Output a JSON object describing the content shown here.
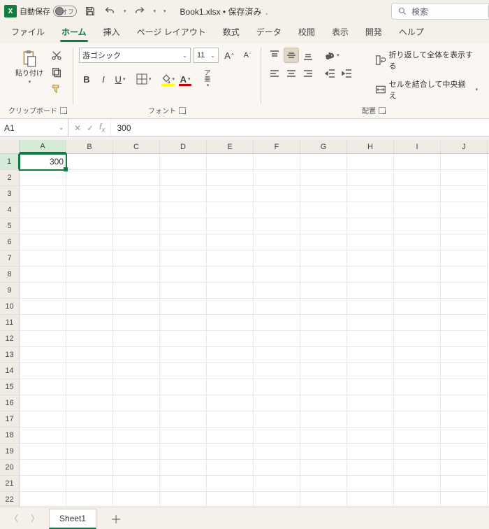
{
  "title": {
    "autosave_label": "自動保存",
    "autosave_state": "オフ",
    "filename": "Book1.xlsx",
    "saved_state": "保存済み"
  },
  "search": {
    "placeholder": "検索"
  },
  "tabs": {
    "file": "ファイル",
    "home": "ホーム",
    "insert": "挿入",
    "layout": "ページ レイアウト",
    "formulas": "数式",
    "data": "データ",
    "review": "校閲",
    "view": "表示",
    "developer": "開発",
    "help": "ヘルプ"
  },
  "ribbon": {
    "clipboard": {
      "paste": "貼り付け",
      "label": "クリップボード"
    },
    "font": {
      "name": "游ゴシック",
      "size": "11",
      "label": "フォント",
      "ruby": "ア\n亜"
    },
    "alignment": {
      "wrap": "折り返して全体を表示する",
      "merge": "セルを結合して中央揃え",
      "label": "配置"
    }
  },
  "fx": {
    "namebox": "A1",
    "formula": "300"
  },
  "grid": {
    "columns": [
      "A",
      "B",
      "C",
      "D",
      "E",
      "F",
      "G",
      "H",
      "I",
      "J"
    ],
    "rows": 22,
    "selected": {
      "row": 1,
      "col": 0
    },
    "cells": {
      "A1": "300"
    }
  },
  "sheet": {
    "name": "Sheet1"
  }
}
